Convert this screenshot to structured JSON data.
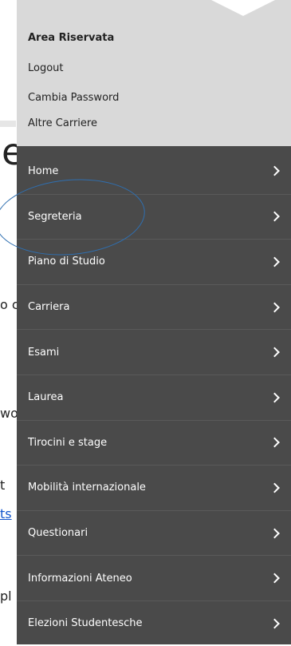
{
  "background": {
    "title_fragment": "e",
    "fragments": [
      {
        "text": "o c",
        "link": false
      },
      {
        "text": "wo",
        "link": false
      },
      {
        "text": "t",
        "link": false
      },
      {
        "text": "ts",
        "link": true
      },
      {
        "text": "pl",
        "link": false
      }
    ]
  },
  "drawer": {
    "section_title": "Area Riservata",
    "links": [
      "Logout",
      "Cambia Password",
      "Altre Carriere"
    ],
    "menu": [
      "Home",
      "Segreteria",
      "Piano di Studio",
      "Carriera",
      "Esami",
      "Laurea",
      "Tirocini e stage",
      "Mobilità internazionale",
      "Questionari",
      "Informazioni Ateneo",
      "Elezioni Studentesche"
    ]
  },
  "colors": {
    "drawer_bg": "#4a4a4a",
    "drawer_header_bg": "#d9d9d9",
    "highlight": "#2f6fb0"
  }
}
